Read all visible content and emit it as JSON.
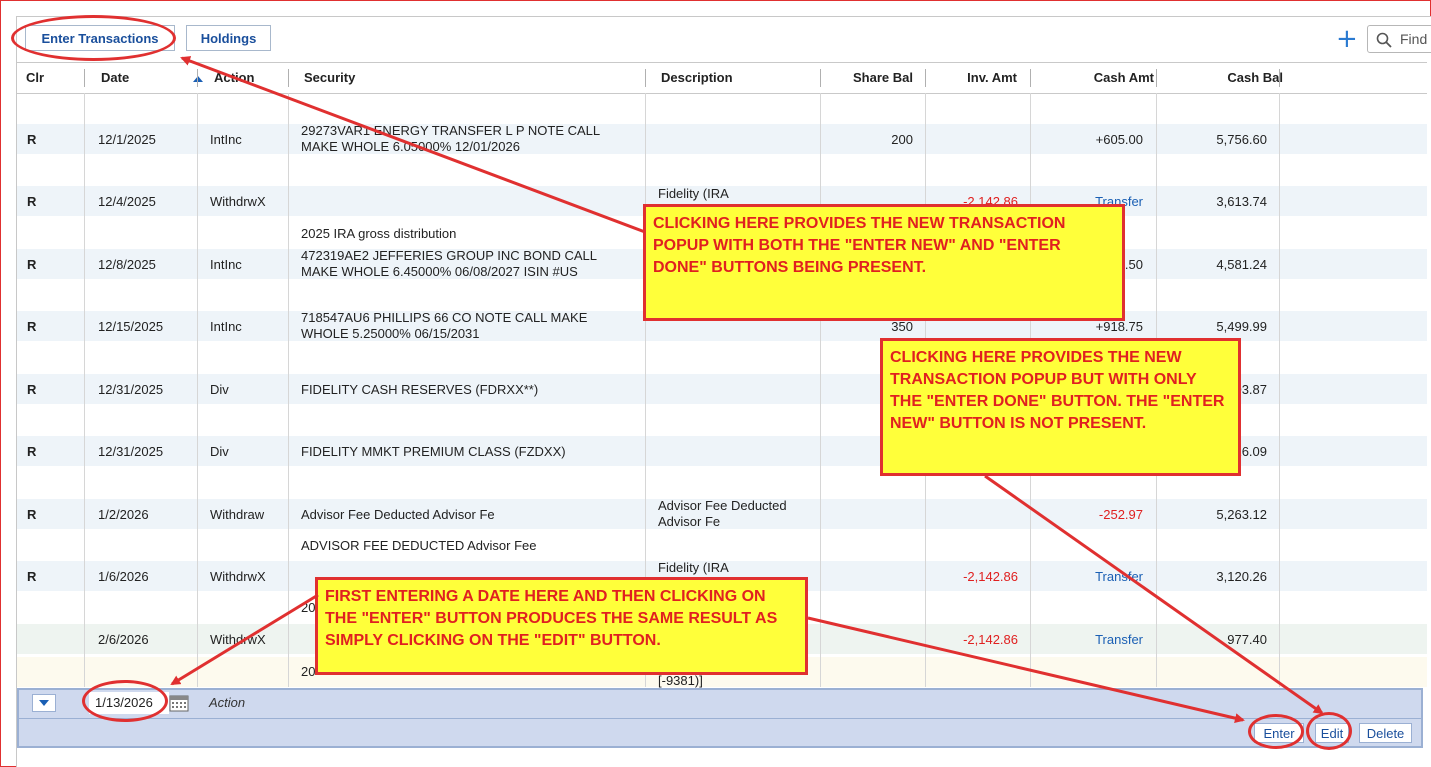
{
  "toolbar": {
    "enter_transactions_label": "Enter Transactions",
    "holdings_label": "Holdings",
    "find_placeholder": "Find"
  },
  "columns": {
    "clr": "Clr",
    "date": "Date",
    "action": "Action",
    "security": "Security",
    "description": "Description",
    "share_bal": "Share Bal",
    "inv_amt": "Inv. Amt",
    "cash_amt": "Cash Amt",
    "cash_bal": "Cash Bal"
  },
  "rows": [
    {
      "clr": "R",
      "date": "12/1/2025",
      "action": "IntInc",
      "security1": "29273VAR1 ENERGY TRANSFER L P NOTE CALL",
      "security2": "MAKE WHOLE 6.05000% 12/01/2026",
      "desc1": "",
      "desc2": "",
      "share_bal": "200",
      "inv_amt": "",
      "cash_amt": "+605.00",
      "cash_bal": "5,756.60"
    },
    {
      "clr": "R",
      "date": "12/4/2025",
      "action": "WithdrwX",
      "security1": "",
      "security2": "",
      "desc1": "Fidelity (IRA",
      "desc2": "",
      "share_bal": "",
      "inv_amt": "-2,142.86",
      "cash_amt": "Transfer",
      "cash_bal": "3,613.74"
    },
    {
      "clr": "R",
      "date": "12/8/2025",
      "action": "IntInc",
      "security1": "472319AE2 JEFFERIES GROUP INC BOND CALL",
      "security2": "MAKE WHOLE 6.45000% 06/08/2027 ISIN #US",
      "desc1": "",
      "desc2": "",
      "share_bal": "",
      "inv_amt": "",
      "cash_amt": "+967.50",
      "cash_bal": "4,581.24"
    },
    {
      "clr": "R",
      "date": "12/15/2025",
      "action": "IntInc",
      "security1": "718547AU6 PHILLIPS 66 CO NOTE CALL MAKE",
      "security2": "WHOLE 5.25000% 06/15/2031",
      "desc1": "",
      "desc2": "",
      "share_bal": "350",
      "inv_amt": "",
      "cash_amt": "+918.75",
      "cash_bal": "5,499.99"
    },
    {
      "clr": "R",
      "date": "12/31/2025",
      "action": "Div",
      "security1": "FIDELITY CASH RESERVES (FDRXX**)",
      "security2": "",
      "desc1": "",
      "desc2": "",
      "share_bal": "",
      "inv_amt": "",
      "cash_amt": "",
      "cash_bal": "5,503.87"
    },
    {
      "clr": "R",
      "date": "12/31/2025",
      "action": "Div",
      "security1": "FIDELITY MMKT PREMIUM CLASS (FZDXX)",
      "security2": "",
      "desc1": "",
      "desc2": "",
      "share_bal": "",
      "inv_amt": "",
      "cash_amt": "",
      "cash_bal": "5,516.09"
    },
    {
      "clr": "R",
      "date": "1/2/2026",
      "action": "Withdraw",
      "security1": "Advisor Fee Deducted Advisor Fe",
      "security2": "",
      "desc1": "Advisor Fee Deducted",
      "desc2": "Advisor Fe",
      "share_bal": "",
      "inv_amt": "",
      "cash_amt": "-252.97",
      "cash_bal": "5,263.12"
    },
    {
      "clr": "R",
      "date": "1/6/2026",
      "action": "WithdrwX",
      "security1": "",
      "security2": "",
      "desc1": "Fidelity (IRA",
      "desc2": "",
      "share_bal": "",
      "inv_amt": "-2,142.86",
      "cash_amt": "Transfer",
      "cash_bal": "3,120.26"
    },
    {
      "clr": "",
      "date": "2/6/2026",
      "action": "WithdrwX",
      "security1": "",
      "security2": "",
      "desc1": "",
      "desc2": "",
      "share_bal": "",
      "inv_amt": "-2,142.86",
      "cash_amt": "Transfer",
      "cash_bal": "977.40"
    }
  ],
  "memo_lines": {
    "m1": "2025 IRA gross distribution",
    "m2": "ADVISOR FEE DEDUCTED Advisor Fee",
    "m3": "20",
    "m4": "20",
    "m5": "[-9381)]"
  },
  "entry": {
    "date_value": "1/13/2026",
    "action_placeholder": "Action",
    "enter_label": "Enter",
    "edit_label": "Edit",
    "delete_label": "Delete"
  },
  "callouts": {
    "top": "CLICKING HERE PROVIDES THE NEW TRANSACTION POPUP WITH BOTH THE \"ENTER NEW\" AND \"ENTER DONE\" BUTTONS BEING PRESENT.",
    "right": "CLICKING HERE PROVIDES THE NEW TRANSACTION POPUP BUT WITH ONLY THE \"ENTER DONE\" BUTTON.  THE \"ENTER NEW\" BUTTON IS NOT PRESENT.",
    "bottom": "FIRST ENTERING A DATE HERE AND THEN CLICKING ON THE \"ENTER\" BUTTON PRODUCES THE SAME RESULT AS SIMPLY CLICKING ON THE \"EDIT\" BUTTON."
  },
  "colors": {
    "accent": "#1a5fb4",
    "negative": "#e02020",
    "callout_fill": "#ffff3a",
    "callout_border": "#e03030"
  }
}
